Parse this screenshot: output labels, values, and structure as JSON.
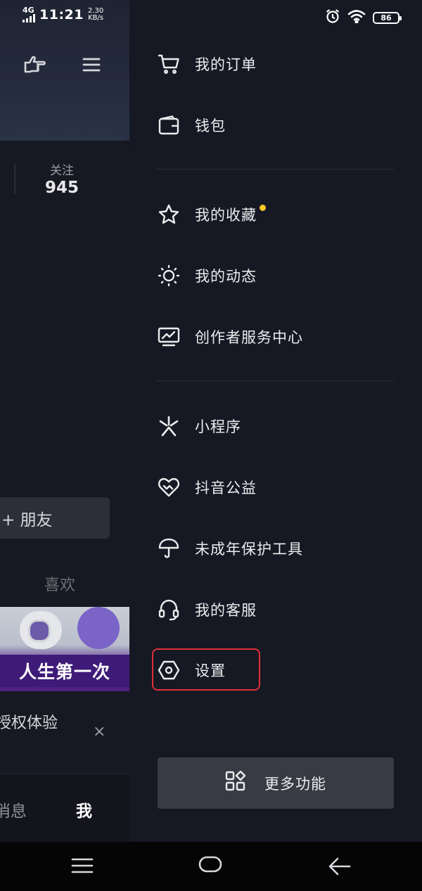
{
  "status_bar": {
    "network": "4G",
    "time": "11:21",
    "speed_value": "2.30",
    "speed_unit": "KB/s",
    "battery": "86"
  },
  "background": {
    "follow_label": "关注",
    "follow_count": "945",
    "friend_button": "+ 朋友",
    "likes_tab": "喜欢",
    "thumbnail_banner": "人生第一次",
    "ad_text": "授权体验",
    "ad_close": "×",
    "tab_messages": "消息",
    "tab_me": "我"
  },
  "drawer": {
    "items": [
      {
        "label": "我的订单",
        "icon": "cart-icon"
      },
      {
        "label": "钱包",
        "icon": "wallet-icon"
      },
      {
        "label": "我的收藏",
        "icon": "star-icon",
        "badge": "dot"
      },
      {
        "label": "我的动态",
        "icon": "sun-icon"
      },
      {
        "label": "创作者服务中心",
        "icon": "creator-monitor-icon"
      },
      {
        "label": "小程序",
        "icon": "mini-program-icon"
      },
      {
        "label": "抖音公益",
        "icon": "charity-heart-icon"
      },
      {
        "label": "未成年保护工具",
        "icon": "umbrella-icon"
      },
      {
        "label": "我的客服",
        "icon": "headset-icon"
      },
      {
        "label": "设置",
        "icon": "settings-hexagon-icon"
      }
    ],
    "more_button": "更多功能",
    "highlighted_item": "设置",
    "highlight_color": "#e0303a",
    "badge_color": "#f9c72b"
  }
}
